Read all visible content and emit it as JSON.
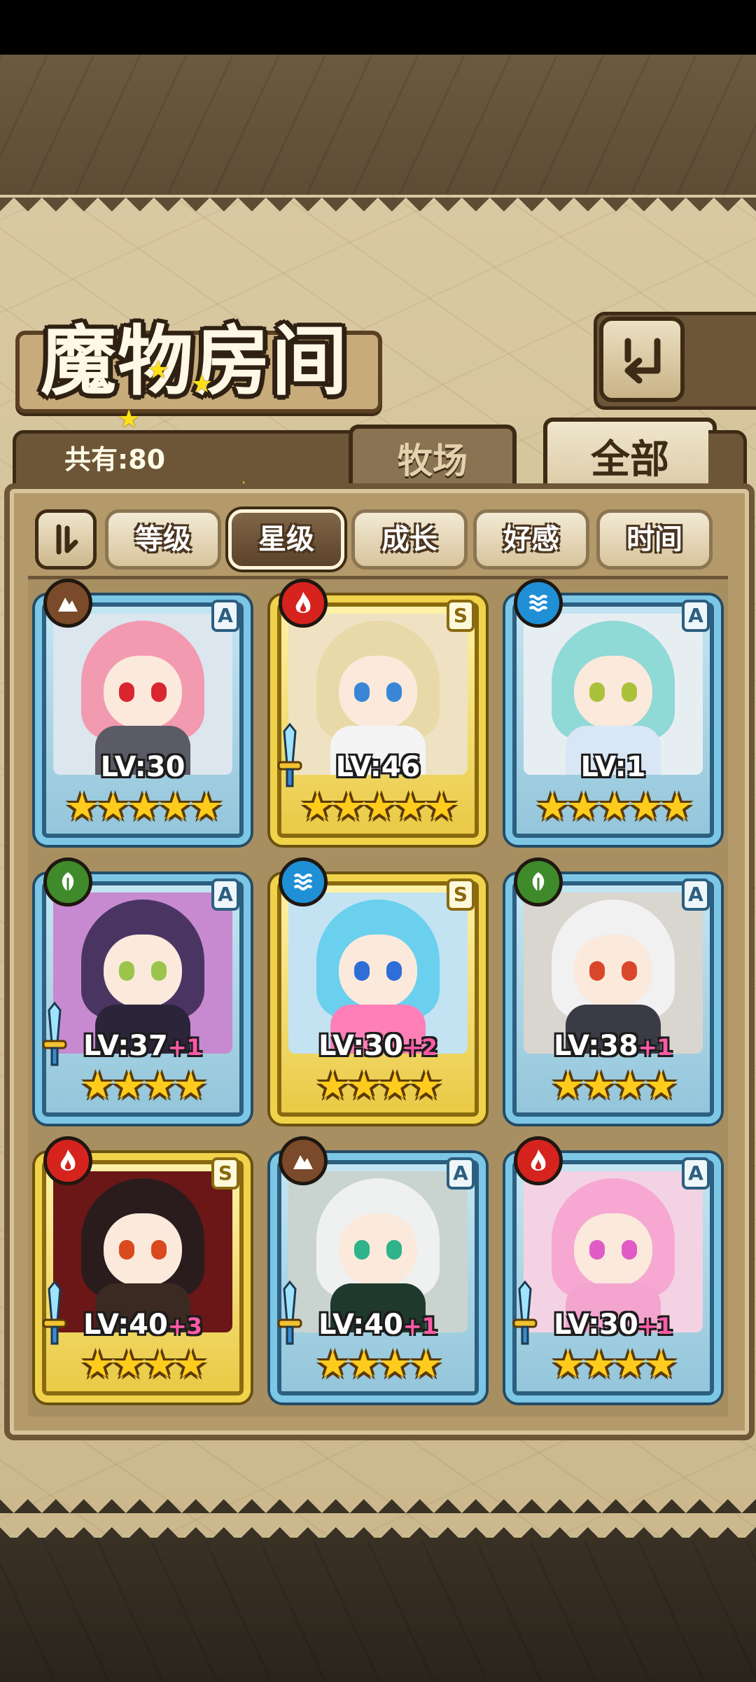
{
  "header": {
    "title": "魔物房间",
    "back_icon": "return-arrow-icon"
  },
  "summary": {
    "count_label": "共有:80"
  },
  "tabs": [
    {
      "label": "牧场",
      "active": false
    },
    {
      "label": "全部",
      "active": true
    }
  ],
  "filters": {
    "sort_icon": "sort-toggle-icon",
    "buttons": [
      {
        "label": "等级",
        "active": false
      },
      {
        "label": "星级",
        "active": true
      },
      {
        "label": "成长",
        "active": false
      },
      {
        "label": "好感",
        "active": false
      },
      {
        "label": "时间",
        "active": false
      }
    ]
  },
  "monsters": [
    {
      "element": "earth",
      "rank": "A",
      "frame": "blue",
      "level": "LV:30",
      "bonus": "",
      "stars": "★★★★★",
      "star_count": 5,
      "equipped": false
    },
    {
      "element": "fire",
      "rank": "S",
      "frame": "gold",
      "level": "LV:46",
      "bonus": "",
      "stars": "★★★★★",
      "star_count": 5,
      "equipped": true
    },
    {
      "element": "water",
      "rank": "A",
      "frame": "blue",
      "level": "LV:1",
      "bonus": "",
      "stars": "★★★★★",
      "star_count": 5,
      "equipped": false
    },
    {
      "element": "wood",
      "rank": "A",
      "frame": "blue",
      "level": "LV:37",
      "bonus": "+1",
      "stars": "★★★★",
      "star_count": 4,
      "equipped": true
    },
    {
      "element": "water",
      "rank": "S",
      "frame": "gold",
      "level": "LV:30",
      "bonus": "+2",
      "stars": "★★★★",
      "star_count": 4,
      "equipped": false
    },
    {
      "element": "wood",
      "rank": "A",
      "frame": "blue",
      "level": "LV:38",
      "bonus": "+1",
      "stars": "★★★★",
      "star_count": 4,
      "equipped": false
    },
    {
      "element": "fire",
      "rank": "S",
      "frame": "gold",
      "level": "LV:40",
      "bonus": "+3",
      "stars": "★★★★",
      "star_count": 4,
      "equipped": true
    },
    {
      "element": "earth",
      "rank": "A",
      "frame": "blue",
      "level": "LV:40",
      "bonus": "+1",
      "stars": "★★★★",
      "star_count": 4,
      "equipped": true
    },
    {
      "element": "fire",
      "rank": "A",
      "frame": "blue",
      "level": "LV:30",
      "bonus": "+1",
      "stars": "★★★★",
      "star_count": 4,
      "equipped": true
    }
  ],
  "colors": {
    "fire": "#d6231e",
    "water": "#1f8fd6",
    "wood": "#3f8a2a",
    "earth": "#7a4a2a",
    "star": "#ffcc1e",
    "bonus": "#ff5aa7"
  }
}
